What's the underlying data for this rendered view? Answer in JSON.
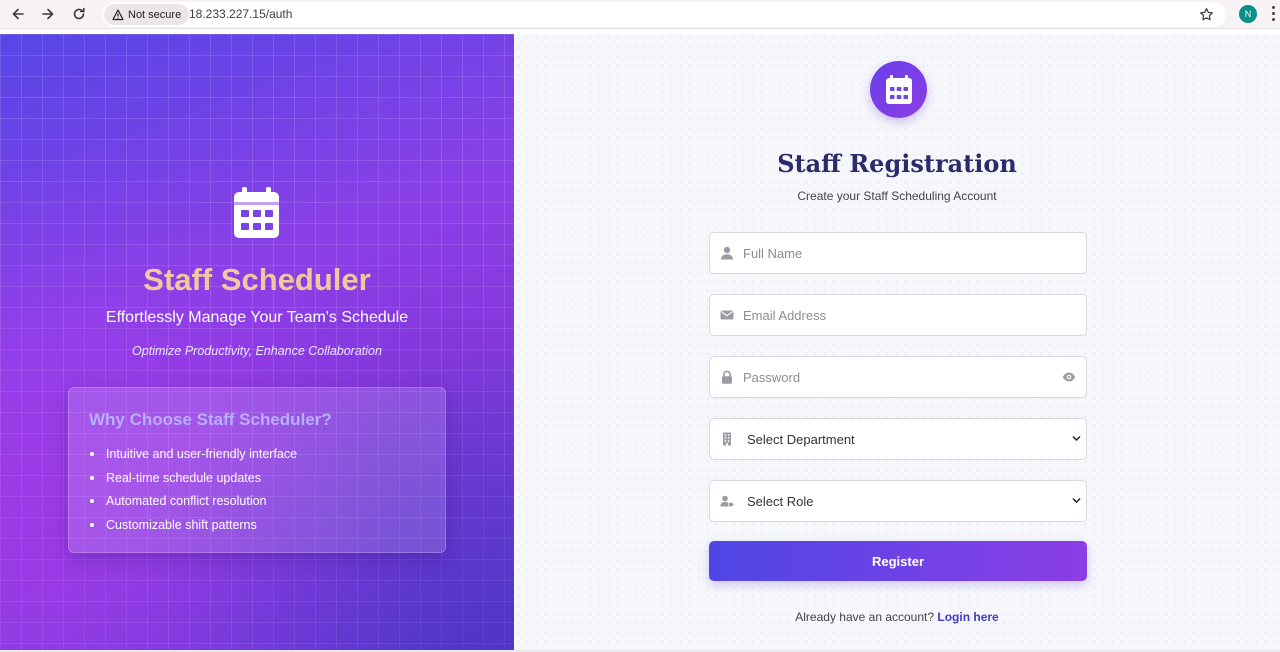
{
  "browser": {
    "security_label": "Not secure",
    "url": "18.233.227.15/auth",
    "profile_initial": "N"
  },
  "hero": {
    "title": "Staff Scheduler",
    "subtitle": "Effortlessly Manage Your Team's Schedule",
    "tagline": "Optimize Productivity, Enhance Collaboration",
    "why_heading": "Why Choose Staff Scheduler?",
    "features": [
      "Intuitive and user-friendly interface",
      "Real-time schedule updates",
      "Automated conflict resolution",
      "Customizable shift patterns"
    ]
  },
  "form": {
    "title": "Staff Registration",
    "subtitle": "Create your Staff Scheduling Account",
    "full_name_placeholder": "Full Name",
    "email_placeholder": "Email Address",
    "password_placeholder": "Password",
    "department_select": "Select Department",
    "role_select": "Select Role",
    "register_label": "Register",
    "login_prompt": "Already have an account?",
    "login_link": "Login here"
  },
  "icons": {
    "back": "back-arrow-icon",
    "forward": "forward-arrow-icon",
    "reload": "reload-icon",
    "warning": "warning-icon",
    "star": "star-icon",
    "calendar": "calendar-icon",
    "user": "user-icon",
    "email": "envelope-icon",
    "lock": "lock-icon",
    "eye": "eye-icon",
    "building": "building-icon",
    "role": "user-tag-icon",
    "chevron": "chevron-down-icon"
  },
  "colors": {
    "accent": "#6a3fe8",
    "title": "#2c2a6b",
    "link": "#4338ca",
    "hero_title": "#f0c8a0"
  }
}
